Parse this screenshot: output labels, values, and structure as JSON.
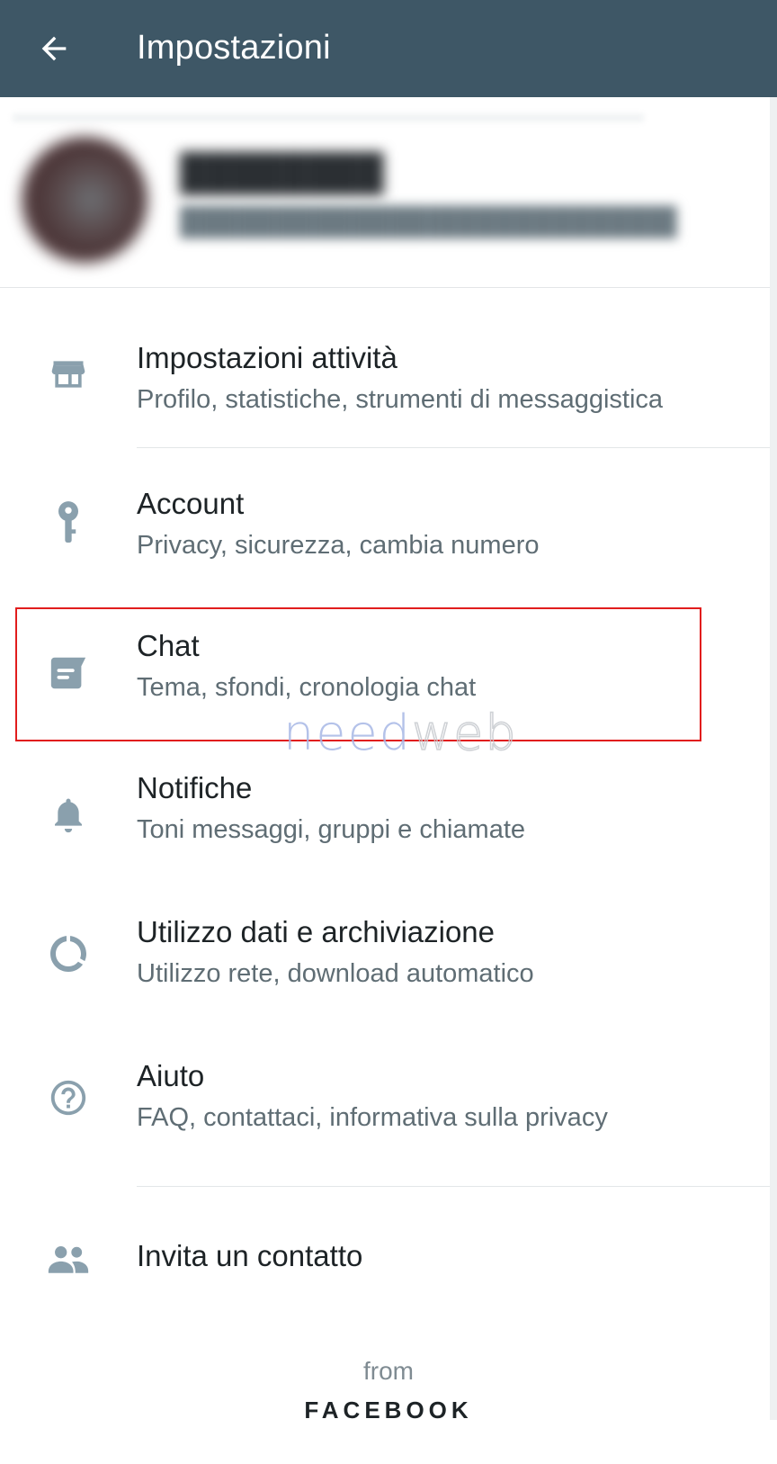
{
  "appbar": {
    "title": "Impostazioni",
    "background": "#3e5766"
  },
  "settings": [
    {
      "icon": "store-icon",
      "title": "Impostazioni attività",
      "subtitle": "Profilo, statistiche, strumenti di messaggistica"
    },
    {
      "icon": "key-icon",
      "title": "Account",
      "subtitle": "Privacy, sicurezza, cambia numero"
    },
    {
      "icon": "chat-icon",
      "title": "Chat",
      "subtitle": "Tema, sfondi, cronologia chat"
    },
    {
      "icon": "bell-icon",
      "title": "Notifiche",
      "subtitle": "Toni messaggi, gruppi e chiamate"
    },
    {
      "icon": "data-usage-icon",
      "title": "Utilizzo dati e archiviazione",
      "subtitle": "Utilizzo rete, download automatico"
    },
    {
      "icon": "help-icon",
      "title": "Aiuto",
      "subtitle": "FAQ, contattaci, informativa sulla privacy"
    },
    {
      "icon": "people-icon",
      "title": "Invita un contatto"
    }
  ],
  "watermark": {
    "part1": "need",
    "part2": "web"
  },
  "footer": {
    "from": "from",
    "brand": "FACEBOOK"
  },
  "colors": {
    "icon": "#8aa0ad",
    "highlight": "#e11d1d"
  }
}
